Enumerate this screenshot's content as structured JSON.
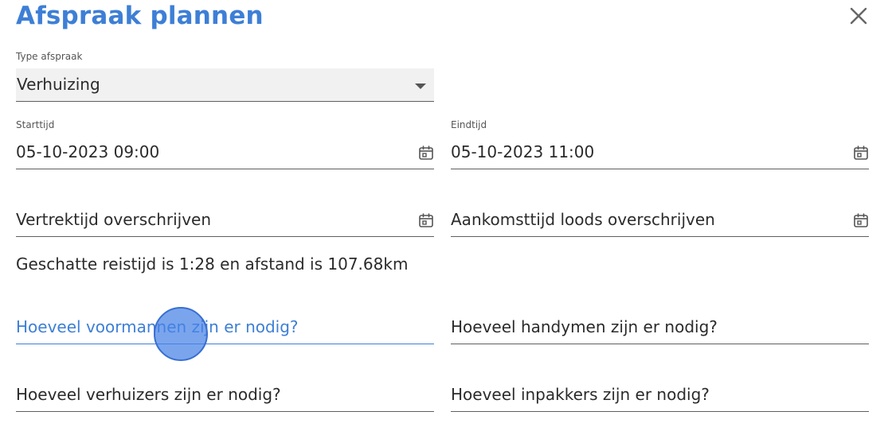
{
  "dialog": {
    "title": "Afspraak plannen"
  },
  "type_field": {
    "label": "Type afspraak",
    "value": "Verhuizing"
  },
  "start_field": {
    "label": "Starttijd",
    "value": "05-10-2023 09:00"
  },
  "end_field": {
    "label": "Eindtijd",
    "value": "05-10-2023 11:00"
  },
  "departure_field": {
    "placeholder": "Vertrektijd overschrijven"
  },
  "arrival_field": {
    "placeholder": "Aankomsttijd loods overschrijven"
  },
  "travel_info": "Geschatte reistijd is 1:28 en afstand is 107.68km",
  "foremen_field": {
    "placeholder": "Hoeveel voormannen zijn er nodig?"
  },
  "handymen_field": {
    "placeholder": "Hoeveel handymen zijn er nodig?"
  },
  "movers_field": {
    "placeholder": "Hoeveel verhuizers zijn er nodig?"
  },
  "packers_field": {
    "placeholder": "Hoeveel inpakkers zijn er nodig?"
  },
  "icons": {
    "close": "close-icon",
    "calendar": "calendar-icon",
    "dropdown": "chevron-down-icon"
  },
  "colors": {
    "accent": "#3d7fd6",
    "text": "#2b2b2b",
    "field_bg": "#f1f1f1"
  }
}
